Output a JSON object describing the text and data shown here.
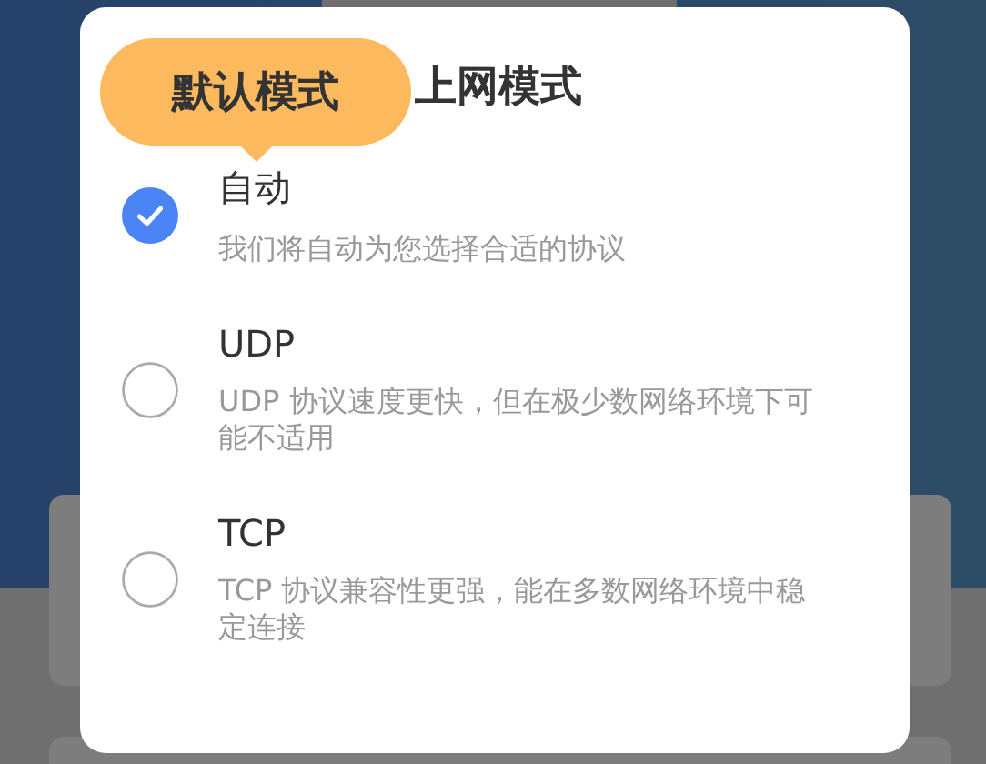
{
  "dialog": {
    "title": "上网模式",
    "tooltip": "默认模式",
    "options": [
      {
        "label": "自动",
        "description": "我们将自动为您选择合适的协议",
        "selected": true
      },
      {
        "label": "UDP",
        "description": "UDP 协议速度更快，但在极少数网络环境下可能不适用",
        "selected": false
      },
      {
        "label": "TCP",
        "description": "TCP 协议兼容性更强，能在多数网络环境中稳定连接",
        "selected": false
      }
    ]
  }
}
